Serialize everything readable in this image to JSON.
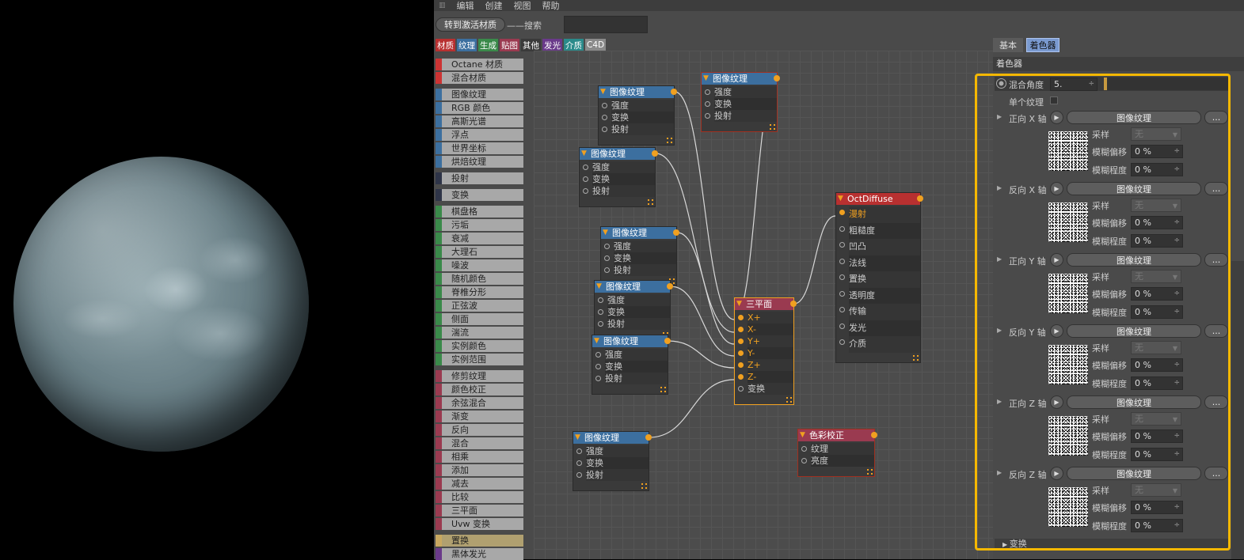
{
  "menu": {
    "items": [
      "编辑",
      "创建",
      "视图",
      "帮助"
    ]
  },
  "toolbar": {
    "goto_label": "转到激活材质",
    "search_label": "搜索",
    "search_value": ""
  },
  "categories": [
    {
      "label": "材质",
      "color": "#b83030"
    },
    {
      "label": "纹理",
      "color": "#3c6f9f"
    },
    {
      "label": "生成",
      "color": "#3a8a4a"
    },
    {
      "label": "贴图",
      "color": "#9a3a50"
    },
    {
      "label": "其他",
      "color": "#3a3a3a"
    },
    {
      "label": "发光",
      "color": "#6a3a8a"
    },
    {
      "label": "介质",
      "color": "#2a8a8a"
    },
    {
      "label": "C4D",
      "color": "#8a8a8a"
    }
  ],
  "palette": [
    "Octane 材质",
    "混合材质",
    "图像纹理",
    "RGB 颜色",
    "高斯光谱",
    "浮点",
    "世界坐标",
    "烘焙纹理",
    "投射",
    "变换",
    "棋盘格",
    "污垢",
    "衰减",
    "大理石",
    "噪波",
    "随机颜色",
    "脊椎分形",
    "正弦波",
    "侧面",
    "湍流",
    "实例颜色",
    "实例范围",
    "修剪纹理",
    "颜色校正",
    "余弦混合",
    "渐变",
    "反向",
    "混合",
    "相乘",
    "添加",
    "减去",
    "比较",
    "三平面",
    "Uvw 变换",
    "置换",
    "黑体发光"
  ],
  "nodes": {
    "img1": {
      "title": "图像纹理",
      "rows": [
        "强度",
        "变换",
        "投射"
      ]
    },
    "img2": {
      "title": "图像纹理",
      "rows": [
        "强度",
        "变换",
        "投射"
      ]
    },
    "img3": {
      "title": "图像纹理",
      "rows": [
        "强度",
        "变换",
        "投射"
      ]
    },
    "img4": {
      "title": "图像纹理",
      "rows": [
        "强度",
        "变换",
        "投射"
      ]
    },
    "img5": {
      "title": "图像纹理",
      "rows": [
        "强度",
        "变换",
        "投射"
      ]
    },
    "img6": {
      "title": "图像纹理",
      "rows": [
        "强度",
        "变换",
        "投射"
      ]
    },
    "img7": {
      "title": "图像纹理",
      "rows": [
        "强度",
        "变换",
        "投射"
      ]
    },
    "triplanar": {
      "title": "三平面",
      "rows": [
        "X+",
        "X-",
        "Y+",
        "Y-",
        "Z+",
        "Z-",
        "变换"
      ]
    },
    "diffuse": {
      "title": "OctDiffuse",
      "rows": [
        "漫射",
        "粗糙度",
        "凹凸",
        "法线",
        "置换",
        "透明度",
        "传输",
        "发光",
        "介质"
      ]
    },
    "colorcorrect": {
      "title": "色彩校正",
      "rows": [
        "纹理",
        "亮度"
      ]
    }
  },
  "panel": {
    "tab_basic": "基本",
    "tab_shader": "着色器",
    "section_title": "着色器",
    "blend_angle_label": "混合角度",
    "blend_angle_value": "5.",
    "single_texture_label": "单个纹理",
    "texture_btn": "图像纹理",
    "more_btn": "...",
    "sample_label": "采样",
    "sample_value": "无",
    "blur_offset_label": "模糊偏移",
    "blur_amount_label": "模糊程度",
    "percent_value": "0 %",
    "axes": [
      "正向 X 轴",
      "反向 X 轴",
      "正向 Y 轴",
      "反向 Y 轴",
      "正向 Z 轴",
      "反向 Z 轴"
    ],
    "transform_label": "变换"
  },
  "colors": {
    "highlight": "#f5b800",
    "port": "#f0a020",
    "texture_header": "#3c6f9f",
    "material_header": "#b83030"
  }
}
